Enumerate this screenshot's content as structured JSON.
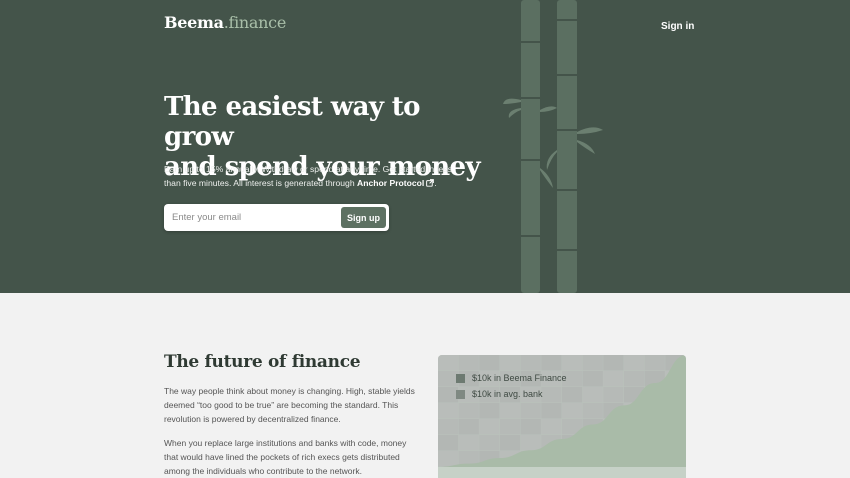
{
  "brand": {
    "name": "Beema",
    "dot": ".",
    "tld": "finance"
  },
  "nav": {
    "signin_label": "Sign in"
  },
  "hero": {
    "headline_line1": "The easiest way to grow",
    "headline_line2": "and spend your money",
    "subtext_before": "Earn up to 15% annually. Withdraw or spend at any time. Get started in less than five minutes. All interest is generated through ",
    "subtext_link": "Anchor Protocol",
    "subtext_after": "."
  },
  "signup": {
    "email_placeholder": "Enter your email",
    "button_label": "Sign up"
  },
  "future_section": {
    "title": "The future of finance",
    "paragraph1": "The way people think about money is changing. High, stable yields deemed “too good to be true” are becoming the standard. This revolution is powered by decentralized finance.",
    "paragraph2": "When you replace large institutions and banks with code, money that would have lined the pockets of rich execs gets distributed among the individuals who contribute to the network."
  },
  "colors": {
    "hero_bg": "#44544a",
    "accent": "#5d7162",
    "beema_series": "#a9bba8",
    "bank_series": "#979c98"
  },
  "chart_data": {
    "type": "area",
    "series": [
      {
        "name": "$10k in Beema Finance",
        "values": [
          0.0,
          0.03,
          0.08,
          0.15,
          0.25,
          0.38,
          0.55,
          0.75,
          1.0
        ]
      },
      {
        "name": "$10k in avg. bank",
        "values": [
          0.0,
          0.0,
          0.0,
          0.0,
          0.0,
          0.0,
          0.0,
          0.0,
          0.0
        ]
      }
    ],
    "legend_placement": "top-left",
    "grid": true
  }
}
